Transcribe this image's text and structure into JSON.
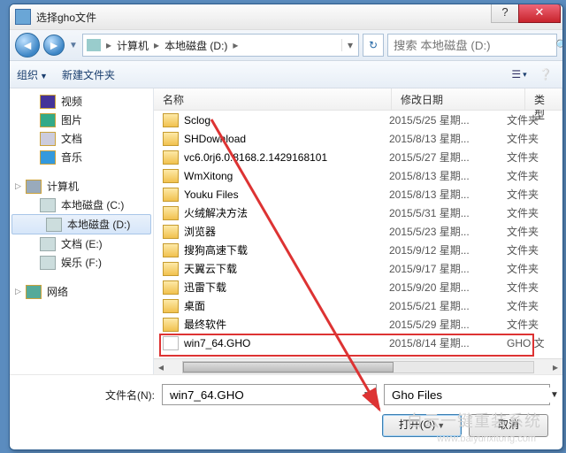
{
  "window": {
    "title": "选择gho文件"
  },
  "breadcrumb": {
    "items": [
      "计算机",
      "本地磁盘 (D:)"
    ]
  },
  "search": {
    "placeholder": "搜索 本地磁盘 (D:)"
  },
  "toolbar": {
    "organize": "组织",
    "newfolder": "新建文件夹"
  },
  "sidebar": {
    "items": [
      {
        "label": "视频",
        "icon": "vid"
      },
      {
        "label": "图片",
        "icon": "pic"
      },
      {
        "label": "文档",
        "icon": "doc"
      },
      {
        "label": "音乐",
        "icon": "mus"
      }
    ],
    "computer_label": "计算机",
    "drives": [
      {
        "label": "本地磁盘 (C:)"
      },
      {
        "label": "本地磁盘 (D:)",
        "selected": true
      },
      {
        "label": "文档 (E:)"
      },
      {
        "label": "娱乐 (F:)"
      }
    ],
    "network_label": "网络"
  },
  "columns": {
    "name": "名称",
    "date": "修改日期",
    "type": "类型"
  },
  "files": [
    {
      "name": "Sclog",
      "date": "2015/5/25 星期...",
      "type": "文件夹",
      "kind": "folder"
    },
    {
      "name": "SHDownload",
      "date": "2015/8/13 星期...",
      "type": "文件夹",
      "kind": "folder"
    },
    {
      "name": "vc6.0rj6.0.8168.2.1429168101",
      "date": "2015/5/27 星期...",
      "type": "文件夹",
      "kind": "folder"
    },
    {
      "name": "WmXitong",
      "date": "2015/8/13 星期...",
      "type": "文件夹",
      "kind": "folder"
    },
    {
      "name": "Youku Files",
      "date": "2015/8/13 星期...",
      "type": "文件夹",
      "kind": "folder"
    },
    {
      "name": "火绒解决方法",
      "date": "2015/5/31 星期...",
      "type": "文件夹",
      "kind": "folder"
    },
    {
      "name": "浏览器",
      "date": "2015/5/23 星期...",
      "type": "文件夹",
      "kind": "folder"
    },
    {
      "name": "搜狗高速下载",
      "date": "2015/9/12 星期...",
      "type": "文件夹",
      "kind": "folder"
    },
    {
      "name": "天翼云下载",
      "date": "2015/9/17 星期...",
      "type": "文件夹",
      "kind": "folder"
    },
    {
      "name": "迅雷下载",
      "date": "2015/9/20 星期...",
      "type": "文件夹",
      "kind": "folder"
    },
    {
      "name": "桌面",
      "date": "2015/5/21 星期...",
      "type": "文件夹",
      "kind": "folder"
    },
    {
      "name": "最终软件",
      "date": "2015/5/29 星期...",
      "type": "文件夹",
      "kind": "folder"
    },
    {
      "name": "win7_64.GHO",
      "date": "2015/8/14 星期...",
      "type": "GHO 文",
      "kind": "file",
      "selected": true
    }
  ],
  "filename": {
    "label": "文件名(N):",
    "value": "win7_64.GHO"
  },
  "filter": {
    "value": "Gho Files"
  },
  "buttons": {
    "open": "打开(O)",
    "cancel": "取消"
  },
  "watermark": {
    "brand": "白云一键重装系统",
    "url": "www.baiyunxitong.com"
  }
}
